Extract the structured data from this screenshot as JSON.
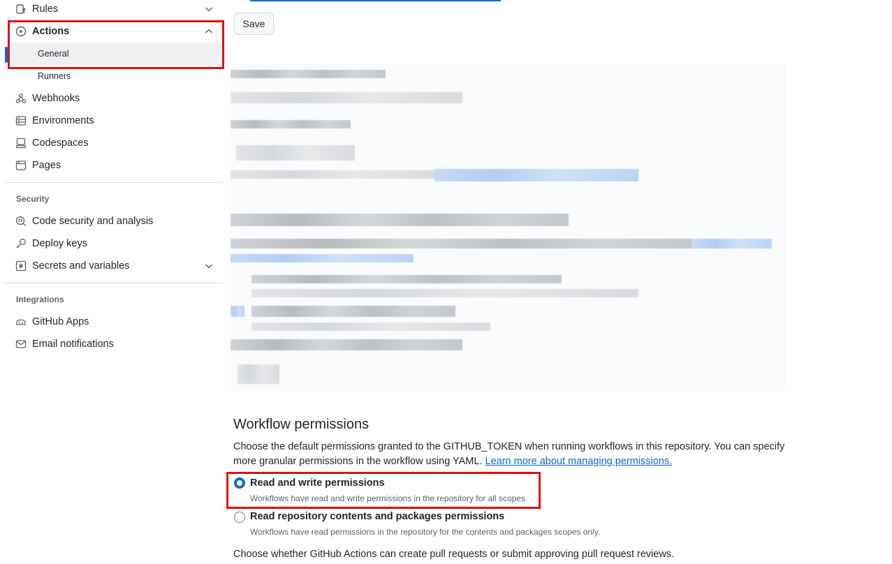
{
  "sidebar": {
    "items": [
      {
        "label": "Rules",
        "icon": "rules-icon"
      },
      {
        "label": "Actions",
        "icon": "play-icon"
      },
      {
        "label": "Webhooks",
        "icon": "webhook-icon"
      },
      {
        "label": "Environments",
        "icon": "server-icon"
      },
      {
        "label": "Codespaces",
        "icon": "codespaces-icon"
      },
      {
        "label": "Pages",
        "icon": "browser-icon"
      }
    ],
    "actions_sub": [
      "General",
      "Runners"
    ],
    "security_heading": "Security",
    "security_items": [
      {
        "label": "Code security and analysis",
        "icon": "codescan-icon"
      },
      {
        "label": "Deploy keys",
        "icon": "key-icon"
      },
      {
        "label": "Secrets and variables",
        "icon": "asterisk-icon"
      }
    ],
    "integrations_heading": "Integrations",
    "integration_items": [
      {
        "label": "GitHub Apps",
        "icon": "apps-icon"
      },
      {
        "label": "Email notifications",
        "icon": "mail-icon"
      }
    ]
  },
  "main": {
    "save_label": "Save",
    "workflow_permissions": {
      "title": "Workflow permissions",
      "description": "Choose the default permissions granted to the GITHUB_TOKEN when running workflows in this repository. You can specify more granular permissions in the workflow using YAML.",
      "learn_more": "Learn more about managing permissions.",
      "options": [
        {
          "label": "Read and write permissions",
          "note": "Workflows have read and write permissions in the repository for all scopes.",
          "checked": true
        },
        {
          "label": "Read repository contents and packages permissions",
          "note": "Workflows have read permissions in the repository for the contents and packages scopes only.",
          "checked": false
        }
      ],
      "pr_text": "Choose whether GitHub Actions can create pull requests or submit approving pull request reviews."
    }
  },
  "colors": {
    "accent": "#0969da",
    "highlight": "#e41010",
    "selected_bg": "#eef0f2"
  }
}
